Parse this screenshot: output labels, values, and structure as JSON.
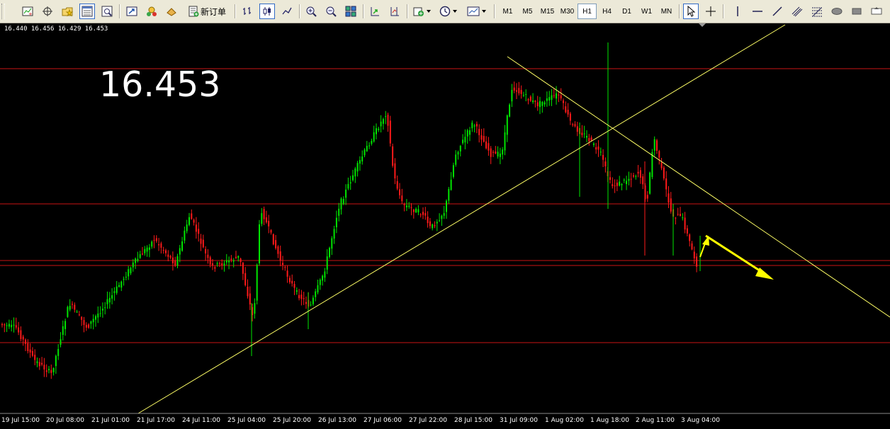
{
  "toolbar": {
    "new_order_label": "新订单",
    "timeframes": [
      "M1",
      "M5",
      "M15",
      "M30",
      "H1",
      "H4",
      "D1",
      "W1",
      "MN"
    ],
    "active_timeframe": "H1",
    "accent": "#316ac5"
  },
  "chart": {
    "ohlc_readout": "16.440 16.456 16.429 16.453",
    "big_price": "16.453",
    "x_labels": [
      "19 Jul 15:00",
      "20 Jul 08:00",
      "21 Jul 01:00",
      "21 Jul 17:00",
      "24 Jul 11:00",
      "25 Jul 04:00",
      "25 Jul 20:00",
      "26 Jul 13:00",
      "27 Jul 06:00",
      "27 Jul 22:00",
      "28 Jul 15:00",
      "31 Jul 09:00",
      "1 Aug 02:00",
      "1 Aug 18:00",
      "2 Aug 11:00",
      "3 Aug 04:00"
    ],
    "colors": {
      "background": "#000000",
      "bull": "#00e600",
      "bear": "#ff1a1a",
      "level_line": "#c81414",
      "trend_line": "#ffff66",
      "arrow": "#ffff00"
    }
  }
}
